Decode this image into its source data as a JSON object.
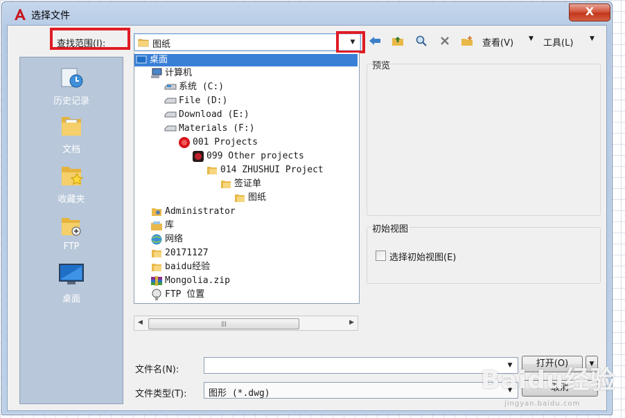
{
  "window": {
    "title": "选择文件",
    "close_label": "X"
  },
  "lookin": {
    "label": "查找范围(I):",
    "value": "图纸"
  },
  "toolbar": {
    "view_label": "查看(V)",
    "tools_label": "工具(L)"
  },
  "places": [
    {
      "label": "历史记录",
      "icon": "history-icon"
    },
    {
      "label": "文档",
      "icon": "documents-folder-icon"
    },
    {
      "label": "收藏夹",
      "icon": "favorites-folder-icon"
    },
    {
      "label": "FTP",
      "icon": "ftp-icon"
    },
    {
      "label": "桌面",
      "icon": "desktop-icon"
    }
  ],
  "tree": [
    {
      "label": "桌面",
      "icon": "desktop-icon",
      "selected": true
    },
    {
      "label": "计算机",
      "icon": "computer-icon"
    },
    {
      "label": "系统 (C:)",
      "icon": "system-drive-icon"
    },
    {
      "label": "File (D:)",
      "icon": "drive-icon"
    },
    {
      "label": "Download (E:)",
      "icon": "drive-icon"
    },
    {
      "label": "Materials (F:)",
      "icon": "drive-icon"
    },
    {
      "label": "001 Projects",
      "icon": "red-folder-icon"
    },
    {
      "label": "099 Other projects",
      "icon": "dark-folder-icon"
    },
    {
      "label": "014 ZHUSHUI Project",
      "icon": "folder-icon"
    },
    {
      "label": "签证单",
      "icon": "folder-icon"
    },
    {
      "label": "图纸",
      "icon": "folder-icon"
    },
    {
      "label": "Administrator",
      "icon": "user-folder-icon"
    },
    {
      "label": "库",
      "icon": "library-icon"
    },
    {
      "label": "网络",
      "icon": "network-icon"
    },
    {
      "label": "20171127",
      "icon": "folder-icon"
    },
    {
      "label": "baidu经验",
      "icon": "folder-icon"
    },
    {
      "label": "Mongolia.zip",
      "icon": "zip-archive-icon"
    },
    {
      "label": "FTP 位置",
      "icon": "ftp-location-icon"
    }
  ],
  "preview": {
    "label": "预览"
  },
  "initial_view": {
    "group_label": "初始视图",
    "checkbox_label": "选择初始视图(E)",
    "checked": false
  },
  "filename": {
    "label": "文件名(N):",
    "value": ""
  },
  "filetype": {
    "label": "文件类型(T):",
    "value": "图形 (*.dwg)"
  },
  "buttons": {
    "open_label": "打开(O)",
    "cancel_label": "取消"
  },
  "watermark": {
    "text": "Baidu经验",
    "sub": "jingyan.baidu.com"
  },
  "colors": {
    "highlight": "#e01b24",
    "selection": "#3a7fd6",
    "places_bg": "#b8c7d9"
  }
}
